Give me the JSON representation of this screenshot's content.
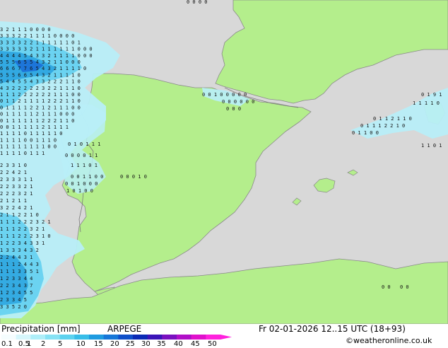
{
  "map": {
    "colors": {
      "sea": "#d8d8d8",
      "land": "#b4ee8c",
      "coast": "#8a8a8a",
      "border": "#7a7a7a",
      "precip_light": "#b8eef8",
      "precip_mid": "#66d2f0",
      "precip_heavy": "#2fa6e0",
      "precip_core": "#1b6fd8"
    },
    "value_labels": [
      "3 2 1 1 1 0 0 0 0",
      "3 3 3 2 2 1 1 1 1 0 0 0 0",
      "3 3 3 3 2 2 1 1 1 1 1 1 0 1",
      "3 3 3 3 3 2 1 1 1 1 1 1 1 0 0 0",
      "4 4 4 4 5 4 3 3 2 1 1 1 1 0 0 0",
      "5 5 5 6 5 5 4 3 2 1 1 0 0 0",
      "6 6 6 7 7 6 5 4 3 2 1 1 1 1 0",
      "5 5 5 6 6 5 4 3 2 1 1 1 1 0",
      "5 4 4 5 5 4 3 3 2 2 2 1 1 0",
      "4 3 2 2 2 2 2 3 2 2 1 1 1 0",
      "1 1 1 2 2 2 2 2 2 1 1 1 0 0",
      "0 1 1 2 1 1 1 1 2 2 2 1 1 0",
      "0 1 1 1 1 2 2 1 2 1 1 1 0 0",
      "0 1 1 1 1 1 2 1 1 1 0 0 0",
      "0 1 1 1 1 1 1 2 2 2 1 1 0",
      "0 0 1 1 1 1 1 2 1 1 1 1",
      "1 1 1 1 0 1 1 1 1 1 0",
      "1 1 1 1 0 0 1 1 1 0",
      "1 1 1 1 1 1 1 1 0 0",
      "1 1 1 1 0 1 1 1"
    ],
    "coast_labels": [
      "2 3 3 1 0",
      "2 2 4 2 1",
      "2 3 3 3 1 1",
      "2 2 3 3 2 1",
      "2 2 2 3 2 1",
      "2 1 2 1 1",
      "3 2 2 4 2 1",
      "2 1 1 2 2 1 0",
      "1 1 1 2 2 2 3 2 1",
      "1 1 1 2 2 3 2 1",
      "1 1 1 2 2 2 3 1 0",
      "1 2 2 3 4 3 3 1",
      "1 3 3 3 4 3 2",
      "2 2 4 4 3 1",
      "1 1 1 2 4 4 3",
      "1 1 1 3 3 5 1",
      "1 2 3 3 4 4",
      "2 2 3 4 3 7",
      "1 2 3 4 5 5",
      "2 3 3 4 5",
      "3 3 5 2 0"
    ],
    "med_labels": [
      "0 1 9 1",
      "1 1 1 1 0",
      "0 1 1 2 1 1 0",
      "0 1 1 1 2 2 1 0",
      "0 1 1 0 0",
      "1 1 0 1"
    ],
    "central_labels": [
      "0 0 1 0 0 0 0 0",
      "0 0 0 0 0 0",
      "0 0 0"
    ],
    "iberia_labels": [
      "0 1 0 1 1 1",
      "0 0 0 0 1 1",
      "1 1 1 0 1",
      "0 0 1 1 0 0",
      "0 0 1 0 0 0",
      "1 0 1 0 0",
      "0 0 0 1 0"
    ]
  },
  "footer": {
    "title": "Precipitation [mm]",
    "model": "ARPEGE",
    "datetime": "Fr 02-01-2026 12..15 UTC (18+93)",
    "credit": "©weatheronline.co.uk",
    "scale_labels": [
      "0.1",
      "0.5",
      "1",
      "2",
      "5",
      "10",
      "15",
      "20",
      "25",
      "30",
      "35",
      "40",
      "45",
      "50"
    ],
    "scale_colors": [
      "#f5fdfe",
      "#d6f6fb",
      "#aeeef8",
      "#86e2f4",
      "#5cd2ef",
      "#37bde8",
      "#1e9be0",
      "#1677d8",
      "#0f4fc9",
      "#0a2ab5",
      "#3b14b8",
      "#7a10c0",
      "#b00fc8",
      "#e011cc",
      "#ff22dd"
    ]
  }
}
